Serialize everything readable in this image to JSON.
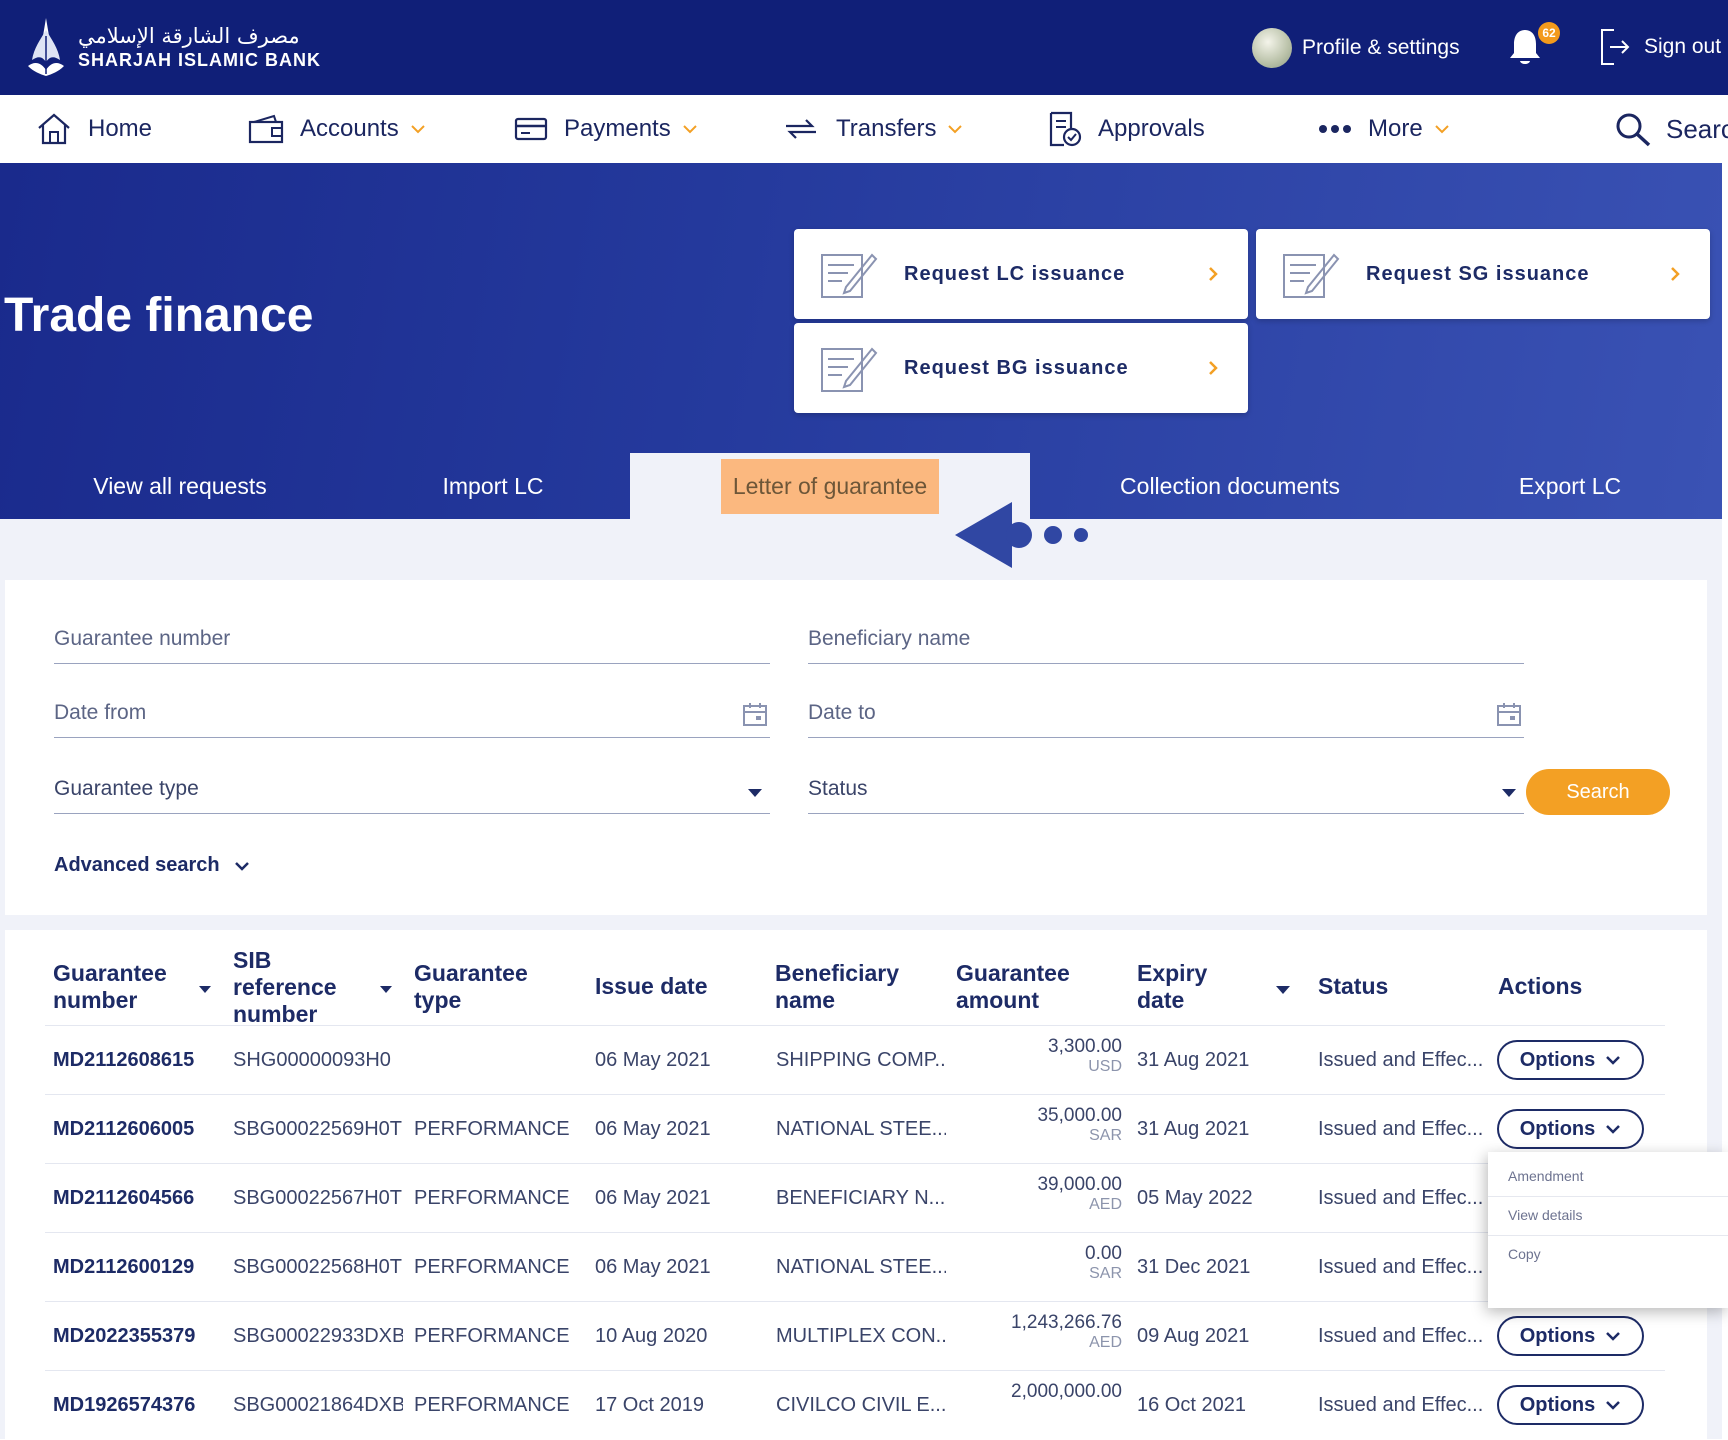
{
  "header": {
    "bank_name_ar": "مصرف الشارقة الإسلامي",
    "bank_name_en": "SHARJAH ISLAMIC BANK",
    "profile_label": "Profile & settings",
    "notification_count": "62",
    "signout_label": "Sign out"
  },
  "nav": {
    "items": [
      {
        "label": "Home",
        "icon": "home-icon"
      },
      {
        "label": "Accounts",
        "icon": "wallet-icon"
      },
      {
        "label": "Payments",
        "icon": "card-icon"
      },
      {
        "label": "Transfers",
        "icon": "transfer-icon"
      },
      {
        "label": "Approvals",
        "icon": "approval-icon"
      },
      {
        "label": "More",
        "icon": "more-dots-icon"
      }
    ],
    "search_label": "Search"
  },
  "hero": {
    "title": "Trade finance",
    "quick_actions": [
      {
        "label": "Request LC issuance"
      },
      {
        "label": "Request SG issuance"
      },
      {
        "label": "Request BG issuance"
      }
    ]
  },
  "tabs": [
    {
      "label": "View all requests"
    },
    {
      "label": "Import LC"
    },
    {
      "label": "Letter of guarantee"
    },
    {
      "label": "Collection documents"
    },
    {
      "label": "Export LC"
    }
  ],
  "active_tab": "Letter of guarantee",
  "filters": {
    "guarantee_number": "Guarantee number",
    "beneficiary_name": "Beneficiary name",
    "date_from": "Date from",
    "date_to": "Date to",
    "guarantee_type": "Guarantee type",
    "status": "Status",
    "search_button": "Search",
    "advanced_search": "Advanced search"
  },
  "table": {
    "headers": {
      "guarantee_number": [
        "Guarantee",
        "number"
      ],
      "sib_reference": [
        "SIB",
        "reference",
        "number"
      ],
      "guarantee_type": [
        "Guarantee",
        "type"
      ],
      "issue_date": "Issue date",
      "beneficiary_name": [
        "Beneficiary",
        "name"
      ],
      "guarantee_amount": [
        "Guarantee",
        "amount"
      ],
      "expiry_date": [
        "Expiry",
        "date"
      ],
      "status": "Status",
      "actions": "Actions"
    },
    "options_label": "Options",
    "rows": [
      {
        "guarantee_number": "MD2112608615",
        "sib_ref": "SHG00000093H0",
        "type": "",
        "issue_date": "06 May 2021",
        "beneficiary": "SHIPPING COMP...",
        "amount": "3,300.00",
        "currency": "USD",
        "expiry_date": "31 Aug 2021",
        "status": "Issued and Effec..."
      },
      {
        "guarantee_number": "MD2112606005",
        "sib_ref": "SBG00022569H0T",
        "type": "PERFORMANCE",
        "issue_date": "06 May 2021",
        "beneficiary": "NATIONAL STEE...",
        "amount": "35,000.00",
        "currency": "SAR",
        "expiry_date": "31 Aug 2021",
        "status": "Issued and Effec..."
      },
      {
        "guarantee_number": "MD2112604566",
        "sib_ref": "SBG00022567H0T",
        "type": "PERFORMANCE",
        "issue_date": "06 May 2021",
        "beneficiary": "BENEFICIARY N...",
        "amount": "39,000.00",
        "currency": "AED",
        "expiry_date": "05 May 2022",
        "status": "Issued and Effec..."
      },
      {
        "guarantee_number": "MD2112600129",
        "sib_ref": "SBG00022568H0T",
        "type": "PERFORMANCE",
        "issue_date": "06 May 2021",
        "beneficiary": "NATIONAL STEE...",
        "amount": "0.00",
        "currency": "SAR",
        "expiry_date": "31 Dec 2021",
        "status": "Issued and Effec..."
      },
      {
        "guarantee_number": "MD2022355379",
        "sib_ref": "SBG00022933DXB",
        "type": "PERFORMANCE",
        "issue_date": "10 Aug 2020",
        "beneficiary": "MULTIPLEX CON...",
        "amount": "1,243,266.76",
        "currency": "AED",
        "expiry_date": "09 Aug 2021",
        "status": "Issued and Effec..."
      },
      {
        "guarantee_number": "MD1926574376",
        "sib_ref": "SBG00021864DXB",
        "type": "PERFORMANCE",
        "issue_date": "17 Oct 2019",
        "beneficiary": "CIVILCO CIVIL E...",
        "amount": "2,000,000.00",
        "currency": "",
        "expiry_date": "16 Oct 2021",
        "status": "Issued and Effec..."
      }
    ]
  },
  "options_menu": [
    "Amendment",
    "View details",
    "Copy"
  ],
  "colors": {
    "header_bg": "#101f78",
    "accent_orange": "#f3a024",
    "active_tab_highlight": "#fbb87f",
    "text_dark": "#1d2b66"
  }
}
